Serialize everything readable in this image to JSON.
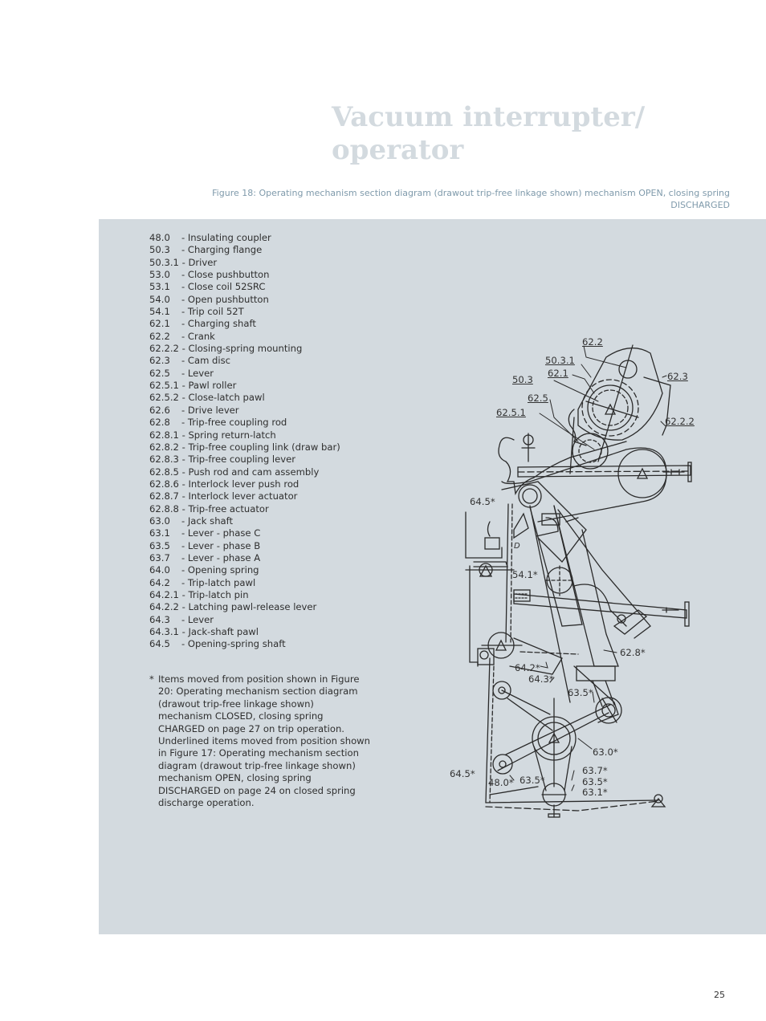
{
  "title": {
    "line1": "Vacuum interrupter/",
    "line2": "operator"
  },
  "caption": "Figure 18: Operating mechanism section diagram (drawout trip-free linkage shown) mechanism OPEN, closing spring DISCHARGED",
  "caption_trailing": ".",
  "legend": [
    {
      "num": "48.0",
      "desc": "- Insulating coupler"
    },
    {
      "num": "50.3",
      "desc": "- Charging flange"
    },
    {
      "num": "50.3.1",
      "desc": "- Driver"
    },
    {
      "num": "53.0",
      "desc": "- Close pushbutton"
    },
    {
      "num": "53.1",
      "desc": "- Close coil 52SRC"
    },
    {
      "num": "54.0",
      "desc": "- Open pushbutton"
    },
    {
      "num": "54.1",
      "desc": "- Trip coil 52T"
    },
    {
      "num": "62.1",
      "desc": "- Charging shaft"
    },
    {
      "num": "62.2",
      "desc": "- Crank"
    },
    {
      "num": "62.2.2",
      "desc": "- Closing-spring mounting"
    },
    {
      "num": "62.3",
      "desc": "- Cam disc"
    },
    {
      "num": "62.5",
      "desc": "- Lever"
    },
    {
      "num": "62.5.1",
      "desc": "- Pawl roller"
    },
    {
      "num": "62.5.2",
      "desc": "- Close-latch pawl"
    },
    {
      "num": "62.6",
      "desc": "- Drive lever"
    },
    {
      "num": "62.8",
      "desc": "- Trip-free coupling rod"
    },
    {
      "num": "62.8.1",
      "desc": "- Spring return-latch"
    },
    {
      "num": "62.8.2",
      "desc": "- Trip-free coupling link (draw bar)"
    },
    {
      "num": "62.8.3",
      "desc": "- Trip-free coupling lever"
    },
    {
      "num": "62.8.5",
      "desc": "- Push rod and cam assembly"
    },
    {
      "num": "62.8.6",
      "desc": "- Interlock lever push rod"
    },
    {
      "num": "62.8.7",
      "desc": "- Interlock lever actuator"
    },
    {
      "num": "62.8.8",
      "desc": "- Trip-free actuator"
    },
    {
      "num": "63.0",
      "desc": "- Jack shaft"
    },
    {
      "num": "63.1",
      "desc": "- Lever - phase C"
    },
    {
      "num": "63.5",
      "desc": "- Lever - phase B"
    },
    {
      "num": "63.7",
      "desc": "- Lever - phase A"
    },
    {
      "num": "64.0",
      "desc": "- Opening spring"
    },
    {
      "num": "64.2",
      "desc": "- Trip-latch pawl"
    },
    {
      "num": "64.2.1",
      "desc": "- Trip-latch pin"
    },
    {
      "num": "64.2.2",
      "desc": "- Latching pawl-release lever"
    },
    {
      "num": "64.3",
      "desc": "- Lever"
    },
    {
      "num": "64.3.1",
      "desc": "- Jack-shaft pawl"
    },
    {
      "num": "64.5",
      "desc": "- Opening-spring shaft"
    }
  ],
  "footnote": {
    "marker": "*",
    "text": "Items moved from position shown in Figure 20: Operating mechanism section diagram (drawout trip-free linkage shown) mechanism CLOSED, closing spring CHARGED on page 27 on trip operation. Underlined items moved from position shown in Figure 17: Operating mechanism section diagram (drawout trip-free linkage shown) mechanism OPEN, closing spring DISCHARGED on page 24 on closed spring discharge operation."
  },
  "diagram": {
    "labels": {
      "l_62_2": "62.2",
      "l_50_3_1": "50.3.1",
      "l_62_1": "62.1",
      "l_62_3": "62.3",
      "l_50_3": "50.3",
      "l_62_5": "62.5",
      "l_62_5_1": "62.5.1",
      "l_62_2_2": "62.2.2",
      "l_64_5_top": "64.5*",
      "l_d": "D",
      "l_54_1": "54.1*",
      "l_62_8": "62.8*",
      "l_64_2": "64.2*",
      "l_64_3": "64.3*",
      "l_63_5_mid": "63.5*",
      "l_63_0": "63.0*",
      "l_64_5_bot": "64.5*",
      "l_48_0": "48.0*",
      "l_63_5_bot": "63.5*",
      "l_63_7": "63.7*",
      "l_63_5_stack": "63.5*",
      "l_63_1": "63.1*"
    }
  },
  "page_number": "25"
}
